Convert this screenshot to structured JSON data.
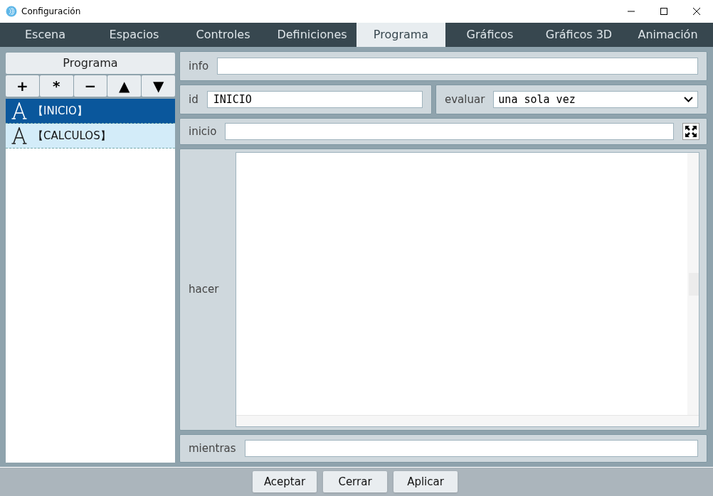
{
  "window": {
    "title": "Configuración"
  },
  "tabs": [
    {
      "label": "Escena",
      "selected": false
    },
    {
      "label": "Espacios",
      "selected": false
    },
    {
      "label": "Controles",
      "selected": false
    },
    {
      "label": "Definiciones",
      "selected": false
    },
    {
      "label": "Programa",
      "selected": true
    },
    {
      "label": "Gráficos",
      "selected": false
    },
    {
      "label": "Gráficos 3D",
      "selected": false
    },
    {
      "label": "Animación",
      "selected": false
    }
  ],
  "sidebar": {
    "title": "Programa",
    "tools": [
      "+",
      "*",
      "−",
      "▲",
      "▼"
    ],
    "items": [
      {
        "label": "【INICIO】",
        "selected": true
      },
      {
        "label": "【CALCULOS】",
        "selected": false
      }
    ]
  },
  "form": {
    "info": {
      "label": "info"
    },
    "id": {
      "label": "id",
      "value": "INICIO"
    },
    "evaluar": {
      "label": "evaluar",
      "value": "una sola vez"
    },
    "inicio": {
      "label": "inicio"
    },
    "hacer": {
      "label": "hacer"
    },
    "mientras": {
      "label": "mientras"
    }
  },
  "buttons": [
    "Aceptar",
    "Cerrar",
    "Aplicar"
  ]
}
